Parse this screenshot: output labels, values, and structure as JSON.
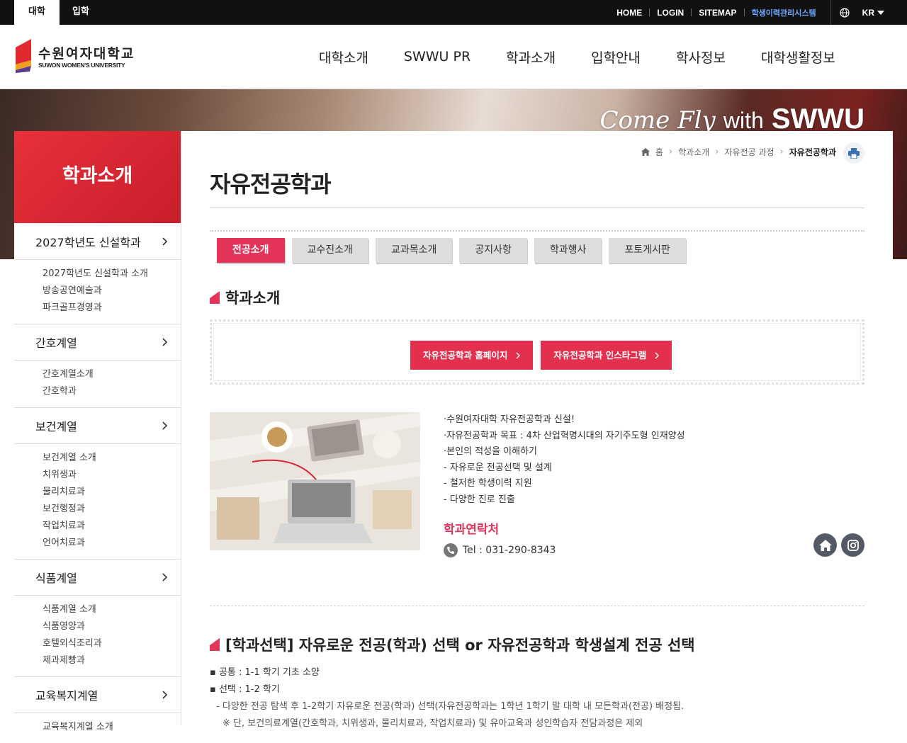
{
  "topbar": {
    "tabs": [
      "대학",
      "입학"
    ],
    "links": [
      "HOME",
      "LOGIN",
      "SITEMAP"
    ],
    "system_link": "학생이력관리시스템",
    "lang": "KR"
  },
  "logo": {
    "ko": "수원여자대학교",
    "en": "SUWON WOMEN'S UNIVERSITY"
  },
  "gnb": [
    "대학소개",
    "SWWU PR",
    "학과소개",
    "입학안내",
    "학사정보",
    "대학생활정보"
  ],
  "hero": {
    "slogan_script": "Come Fly",
    "slogan_with": "with",
    "slogan_brand": "SWWU"
  },
  "lnb": {
    "title": "학과소개",
    "groups": [
      {
        "label": "2027학년도 신설학과",
        "subs": [
          "2027학년도 신설학과 소개",
          "방송공연예술과",
          "파크골프경영과"
        ]
      },
      {
        "label": "간호계열",
        "subs": [
          "간호계열소개",
          "간호학과"
        ]
      },
      {
        "label": "보건계열",
        "subs": [
          "보건계열 소개",
          "치위생과",
          "물리치료과",
          "보건행정과",
          "작업치료과",
          "언어치료과"
        ]
      },
      {
        "label": "식품계열",
        "subs": [
          "식품계열 소개",
          "식품영양과",
          "호텔외식조리과",
          "제과제빵과"
        ]
      },
      {
        "label": "교육복지계열",
        "subs": [
          "교육복지계열 소개"
        ]
      }
    ]
  },
  "breadcrumb": [
    "홈",
    "학과소개",
    "자유전공 과정",
    "자유전공학과"
  ],
  "page_title": "자유전공학과",
  "tabs": [
    "전공소개",
    "교수진소개",
    "교과목소개",
    "공지사항",
    "학과행사",
    "포토게시판"
  ],
  "section1_title": "학과소개",
  "link_buttons": [
    "자유전공학과 홈페이지",
    "자유전공학과 인스타그램"
  ],
  "intro_lines": [
    "·수원여자대학 자유전공학과 신설!",
    "·자유전공학과 목표 : 4차 산업혁명시대의 자기주도형 인재양성",
    "·본인의 적성을 이해하기",
    "- 자유로운 전공선택 및 설계",
    "- 철저한 학생이력 지원",
    "- 다양한 진로 진출"
  ],
  "contact": {
    "title": "학과연락처",
    "tel": "Tel : 031-290-8343"
  },
  "section2_title": "[학과선택] 자유로운 전공(학과) 선택 or 자유전공학과 학생설계 전공 선택",
  "selection_lines": [
    "▪ 공통 : 1-1 학기 기초 소양",
    "▪ 선택 : 1-2 학기",
    "- 다양한 전공 탐색 후 1-2학기 자유로운 전공(학과) 선택(자유전공학과는 1학년 1학기 말 대학 내 모든학과(전공) 배정됨.",
    "※ 단, 보건의료계열(간호학과, 치위생과, 물리치료과, 작업치료과) 및 유아교육과 성인학습자 전담과정은 제외"
  ],
  "colors": {
    "accent": "#e3345a",
    "lnb_title": "#d9252f",
    "topbar": "#111111",
    "link_blue": "#6aa9ff"
  }
}
